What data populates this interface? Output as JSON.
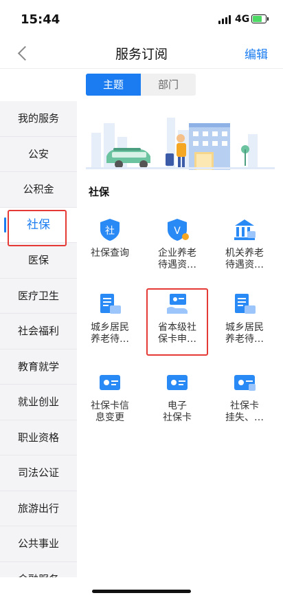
{
  "status_bar": {
    "time": "15:44",
    "network": "4G"
  },
  "navbar": {
    "title": "服务订阅",
    "edit_label": "编辑"
  },
  "tabs": [
    {
      "label": "主题",
      "active": true
    },
    {
      "label": "部门",
      "active": false
    }
  ],
  "sidebar": {
    "items": [
      {
        "label": "我的服务"
      },
      {
        "label": "公安"
      },
      {
        "label": "公积金"
      },
      {
        "label": "社保",
        "active": true
      },
      {
        "label": "医保"
      },
      {
        "label": "医疗卫生"
      },
      {
        "label": "社会福利"
      },
      {
        "label": "教育就学"
      },
      {
        "label": "就业创业"
      },
      {
        "label": "职业资格"
      },
      {
        "label": "司法公证"
      },
      {
        "label": "旅游出行"
      },
      {
        "label": "公共事业"
      },
      {
        "label": "金融服务"
      }
    ]
  },
  "section": {
    "title": "社保"
  },
  "services": [
    {
      "label_1": "社保查询",
      "label_2": "",
      "icon": "shield-she-icon"
    },
    {
      "label_1": "企业养老",
      "label_2": "待遇资…",
      "icon": "shield-v-icon"
    },
    {
      "label_1": "机关养老",
      "label_2": "待遇资…",
      "icon": "bank-icon"
    },
    {
      "label_1": "城乡居民",
      "label_2": "养老待…",
      "icon": "document-card-icon"
    },
    {
      "label_1": "省本级社",
      "label_2": "保卡申…",
      "icon": "card-hand-icon"
    },
    {
      "label_1": "城乡居民",
      "label_2": "养老待…",
      "icon": "document-card-icon"
    },
    {
      "label_1": "社保卡信",
      "label_2": "息变更",
      "icon": "card-icon"
    },
    {
      "label_1": "电子",
      "label_2": "社保卡",
      "icon": "card-icon"
    },
    {
      "label_1": "社保卡",
      "label_2": "挂失、…",
      "icon": "card-lock-icon"
    }
  ],
  "colors": {
    "accent": "#1a7cf0",
    "highlight": "#e53935"
  }
}
